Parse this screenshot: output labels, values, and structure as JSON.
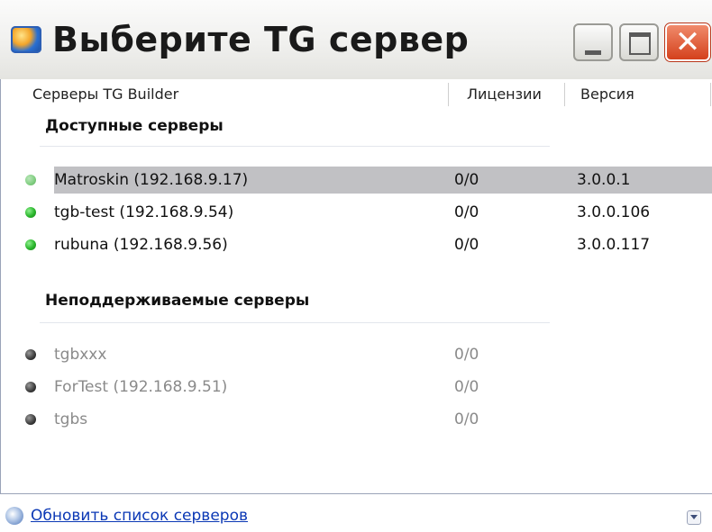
{
  "window": {
    "title": "Выберите TG сервер",
    "controls": {
      "minimize_icon": "minimize-icon",
      "maximize_icon": "maximize-icon",
      "close_glyph": "✕"
    }
  },
  "columns": {
    "servers": "Серверы TG Builder",
    "licenses": "Лицензии",
    "version": "Версия"
  },
  "groups": [
    {
      "title": "Доступные серверы",
      "rows": [
        {
          "name": "Matroskin (192.168.9.17)",
          "licenses": "0/0",
          "version": "3.0.0.1",
          "status": "available",
          "selected": true
        },
        {
          "name": "tgb-test (192.168.9.54)",
          "licenses": "0/0",
          "version": "3.0.0.106",
          "status": "available",
          "selected": false
        },
        {
          "name": "rubuna (192.168.9.56)",
          "licenses": "0/0",
          "version": "3.0.0.117",
          "status": "available",
          "selected": false
        }
      ]
    },
    {
      "title": "Неподдерживаемые серверы",
      "rows": [
        {
          "name": "tgbxxx",
          "licenses": "0/0",
          "version": "",
          "status": "unsupported",
          "selected": false
        },
        {
          "name": "ForTest (192.168.9.51)",
          "licenses": "0/0",
          "version": "",
          "status": "unsupported",
          "selected": false
        },
        {
          "name": "tgbs",
          "licenses": "0/0",
          "version": "",
          "status": "unsupported",
          "selected": false
        }
      ]
    }
  ],
  "footer": {
    "refresh_label": "Обновить список серверов",
    "refresh_icon": "refresh-icon",
    "expand_icon": "chevron-down-icon"
  },
  "colors": {
    "selected_row": "#c1c1c4",
    "link": "#0b38b5",
    "close_button": "#d4411c",
    "available_dot": "#29b52b",
    "unsupported_dot": "#3a3a3a"
  }
}
